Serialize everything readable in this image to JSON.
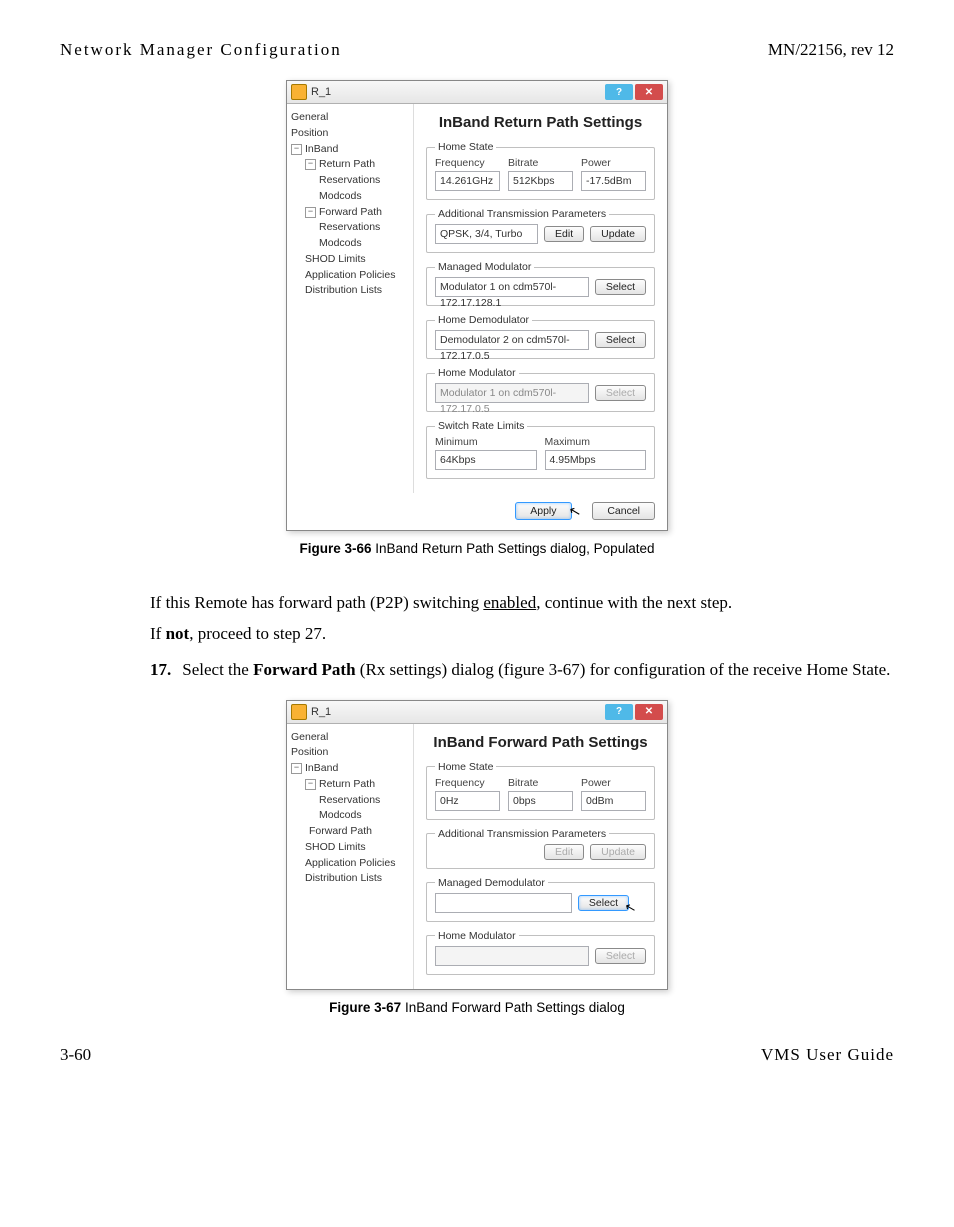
{
  "header": {
    "left": "Network Manager Configuration",
    "right": "MN/22156, rev 12"
  },
  "dialog1": {
    "title": "R_1",
    "tree": {
      "general": "General",
      "position": "Position",
      "inband": "InBand",
      "return_path": "Return Path",
      "reservations1": "Reservations",
      "modcods1": "Modcods",
      "forward_path": "Forward Path",
      "reservations2": "Reservations",
      "modcods2": "Modcods",
      "shod": "SHOD Limits",
      "app_pol": "Application Policies",
      "dist": "Distribution Lists"
    },
    "heading": "InBand Return Path Settings",
    "home_state": {
      "legend": "Home State",
      "freq_label": "Frequency",
      "freq_val": "14.261GHz",
      "bitrate_label": "Bitrate",
      "bitrate_val": "512Kbps",
      "power_label": "Power",
      "power_val": "-17.5dBm"
    },
    "atp": {
      "legend": "Additional Transmission Parameters",
      "val": "QPSK, 3/4, Turbo",
      "edit": "Edit",
      "update": "Update"
    },
    "man_mod": {
      "legend": "Managed Modulator",
      "val": "Modulator 1 on cdm570l-172.17.128.1",
      "select": "Select"
    },
    "home_demod": {
      "legend": "Home Demodulator",
      "val": "Demodulator 2 on cdm570l-172.17.0.5",
      "select": "Select"
    },
    "home_mod": {
      "legend": "Home Modulator",
      "val": "Modulator 1 on cdm570l-172.17.0.5",
      "select": "Select"
    },
    "srl": {
      "legend": "Switch Rate Limits",
      "min_label": "Minimum",
      "min_val": "64Kbps",
      "max_label": "Maximum",
      "max_val": "4.95Mbps"
    },
    "apply": "Apply",
    "cancel": "Cancel"
  },
  "caption1": {
    "bold": "Figure 3-66",
    "rest": "   InBand Return Path Settings dialog, Populated"
  },
  "body": {
    "p1a": "If this Remote has forward path (P2P) switching ",
    "p1link": "enabled",
    "p1b": ", continue with the next step.",
    "p2a": "If ",
    "p2b": "not",
    "p2c": ", proceed to step 27."
  },
  "step17": {
    "num": "17.",
    "a": " Select the ",
    "b": "Forward Path",
    "c": " (Rx settings) dialog (figure 3-67) for configuration of the receive Home State."
  },
  "dialog2": {
    "title": "R_1",
    "tree": {
      "general": "General",
      "position": "Position",
      "inband": "InBand",
      "return_path": "Return Path",
      "reservations1": "Reservations",
      "modcods1": "Modcods",
      "forward_path": "Forward Path",
      "shod": "SHOD Limits",
      "app_pol": "Application Policies",
      "dist": "Distribution Lists"
    },
    "heading": "InBand Forward Path Settings",
    "home_state": {
      "legend": "Home State",
      "freq_label": "Frequency",
      "freq_val": "0Hz",
      "bitrate_label": "Bitrate",
      "bitrate_val": "0bps",
      "power_label": "Power",
      "power_val": "0dBm"
    },
    "atp": {
      "legend": "Additional Transmission Parameters",
      "edit": "Edit",
      "update": "Update"
    },
    "man_demod": {
      "legend": "Managed Demodulator",
      "select": "Select"
    },
    "home_mod": {
      "legend": "Home Modulator",
      "select": "Select"
    }
  },
  "caption2": {
    "bold": "Figure 3-67",
    "rest": "   InBand Forward Path Settings dialog"
  },
  "footer": {
    "left": "3-60",
    "right": "VMS User Guide"
  }
}
